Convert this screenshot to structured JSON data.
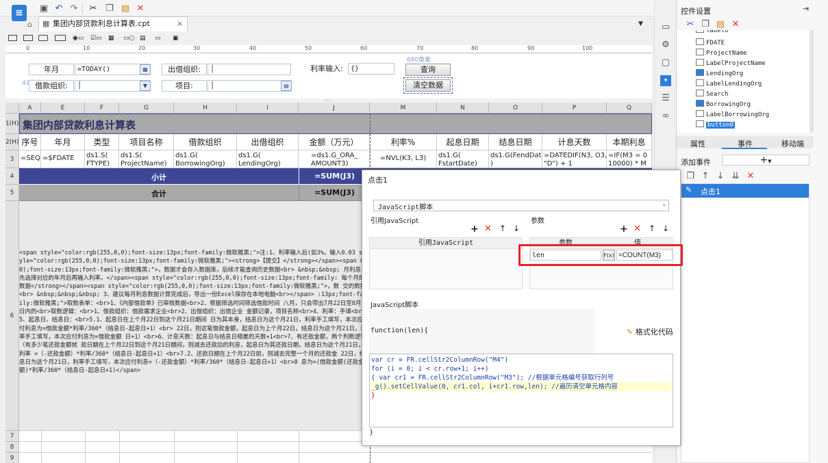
{
  "toolbar": {
    "icons": [
      "app-logo-icon",
      "save-icon",
      "undo-icon",
      "redo-icon",
      "cut-icon",
      "copy-icon",
      "paste-icon",
      "delete-icon"
    ]
  },
  "document_tab": {
    "label": "集团内部贷款利息计算表.cpt"
  },
  "widget_bar": {
    "icons": [
      "label-widget",
      "textbox-widget",
      "button-widget",
      "combobox-widget",
      "radio-widget",
      "checkbox-widget",
      "date-widget",
      "number-widget",
      "tree-widget",
      "list-widget",
      "file-widget"
    ]
  },
  "ruler": {
    "ticks": [
      "0",
      "10",
      "20",
      "30",
      "40",
      "50",
      "60",
      "70",
      "80",
      "90",
      "100"
    ]
  },
  "params": {
    "year_label": "年月",
    "year_value": "=TODAY()",
    "lending_label": "出借组织:",
    "rate_label": "利率输入:",
    "rate_value": "{}",
    "query_button": "查询",
    "clear_button": "清空数据",
    "borrowing_label": "借款组织:",
    "project_label": "项目:",
    "px_hint_1": "680像素",
    "px_hint_2": "41像素"
  },
  "grid": {
    "columns": [
      "A",
      "E",
      "F",
      "G",
      "H",
      "I",
      "J",
      "M",
      "N",
      "O",
      "P",
      "Q"
    ],
    "rows": [
      "1(H)",
      "2(H)",
      "3",
      "4",
      "5",
      "6",
      "7",
      "8",
      "9"
    ],
    "title": "集团内部贷款利息计算表",
    "headers": [
      "序号",
      "年月",
      "类型",
      "项目名称",
      "借款组织",
      "出借组织",
      "金额（万元）",
      "利率%",
      "起息日期",
      "结息日期",
      "计息天数",
      "本期利息"
    ],
    "row3": [
      "=SEQ()",
      "=$FDATE",
      "ds1.S(\nFTYPE)",
      "ds1.S(\nProjectName)",
      "ds1.G(\nBorrowingOrg)",
      "ds1.G(\nLendingOrg)",
      "=ds1.G_ORA_\nAMOUNT3)",
      "=NVL(K3, L3)",
      "ds1.G(\nFstartDate)",
      "ds1.G(FendDate\n)",
      "=DATEDIF(N3, O3,\n\"D\") + 1",
      "=IF(M3 = 0\n10000) * M"
    ],
    "subtotal_label": "小计",
    "subtotal_value": "=SUM(J3)",
    "total_label": "合计",
    "total_value": "=SUM(J3)",
    "row6_text": "<span style=\"color:rgb(255,0,0);font-size:13px;font-family:微软雅黑;\">注:1、利率输入后(如3%，输入0.03 style=\"color:rgb(255,0,0);font-size:13px;font-family:微软雅黑;\"><strong>【提交】</strong></span><span 0,0);font-size:13px;font-family:微软雅黑;\">，数据才会存入数据库，后续才能查询历史数据<br> &nbsp;&nbsp; 月利息，先选择对应的年月后再输入利率。</span><span style=\"color:rgb(255,0,0);font-size:13px;font-family: 每个月的数据</strong></span><span style=\"color:rgb(255,0,0);font-size:13px;font-family:微软雅黑;\">，数 交的数据<br> &nbsp;&nbsp;&nbsp; 3、建议每月利息数据计算完成后，导出一份Excel保存在本地电脑<br></span> :13px;font-family:微软雅黑;\">取数表单：<br>1、《内部借款单》已审核数据<br>2、根据筛选时间筛选借款时间 八月，只会带出7月22日至8月21日内的<br>取数逻辑：<br>1、借款组织：借款需求企业<br>2、出借组织：出借企业 金额记录，项目名称<br>4、利率：手填<br>5、起息日、结息日：<br>5.1、起息日在上个月22日到这个月21日期间 日为其本身，结息日为这个月21日，利率手工填写，本次应付利息为=借款金额*利率/360*（结息日-起息日+1）<br> 22日，则这笔借款金额，起息日为上个月22日，结息日为这个月21日，利率手工填写，本次应付利息为=借款金额 日+1）<br>6、计息天数：起息日与结息日相差的天数+1<br>7、有还款金额，两个判断逻辑（有多少笔还款金额就 款日期在上个月22日到这个月21日期间，则减去还款后的利息，起息日为其还款日期，结息日为这个月21日，利率 =（-还款金额）*利率/360*（结息日-起息日+1）<br>7.2、还款日期在上个月22日前，则减去完整一个月的还款金 22日，结息日为这个月21日，利率手工填写，本次应付利息=（-还款金额）*利率/360*（结息日-起息日+1）<br>8 息为=(借款金额(还款金额)*利率/360*（结息日-起息日+1)</span>"
  },
  "right_panel": {
    "title": "控件设置",
    "tree_items": [
      "label0",
      "FDATE",
      "ProjectName",
      "LabelProjectName",
      "LendingOrg",
      "LabelLendingOrg",
      "Search",
      "BorrowingOrg",
      "LabelBorrowingOrg",
      "button0"
    ],
    "tabs": [
      "属性",
      "事件",
      "移动端"
    ],
    "add_event_label": "添加事件",
    "add_symbol": "+",
    "event_item": "点击1"
  },
  "dialog": {
    "title": "点击1",
    "script_type": "JavaScript脚本",
    "ref_section": "引用JavaScript",
    "ref_column": "引用JavaScript",
    "param_section": "参数",
    "param_col_name": "参数",
    "param_col_value": "值",
    "param_name": "len",
    "param_fx": "F(x)",
    "param_value": "=COUNT(M3)",
    "script_section": "JavaScript脚本",
    "function_sig": "function(len){",
    "format_button": "格式化代码",
    "code_lines": [
      "var cr = FR.cellStr2ColumnRow(\"M4\")",
      "for (i = 0; i < cr.row+1; i++)",
      "{ var cr1 = FR.cellStr2ColumnRow(\"M3\"); //根据单元格编号获取行列号",
      "_g().setCellValue(0, cr1.col, i+cr1.row,len); //遍历清空单元格内容",
      "}"
    ],
    "closing_brace": "}"
  },
  "colors": {
    "accent_blue": "#3d4796",
    "title_row": "#a9a9a9",
    "highlight_red": "#e8202a",
    "code_highlight": "#ffffd0"
  }
}
